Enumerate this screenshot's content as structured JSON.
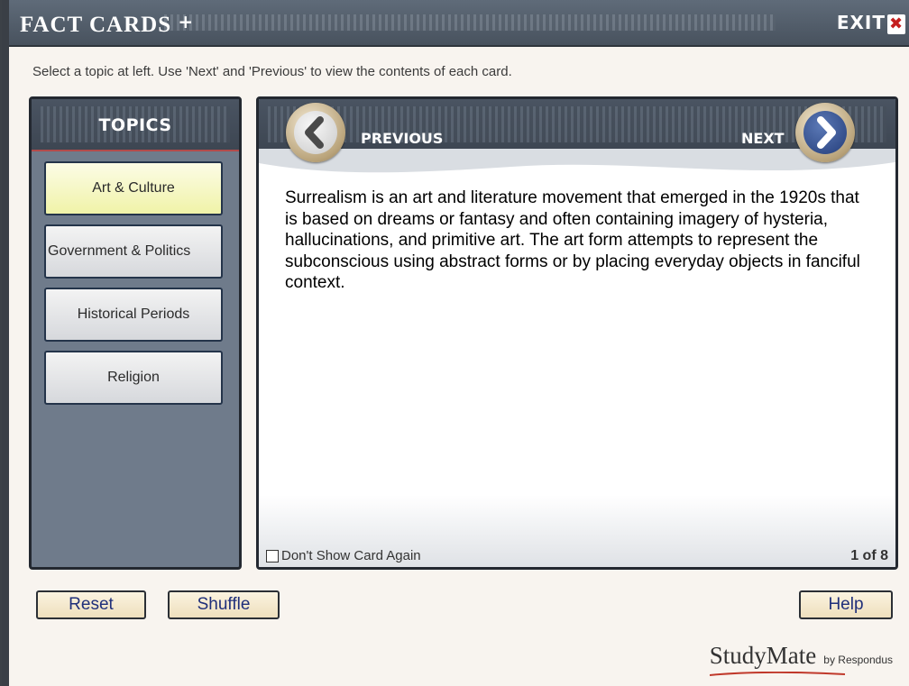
{
  "app": {
    "logo_text": "FACT CARDS",
    "logo_plus": "+",
    "exit_label": "EXIT",
    "exit_icon": "✖"
  },
  "instruction": "Select a topic at left. Use 'Next' and 'Previous' to view the contents of each card.",
  "topics": {
    "header": "TOPICS",
    "items": [
      {
        "label": "Art & Culture",
        "selected": true
      },
      {
        "label": "Government & Politics",
        "selected": false
      },
      {
        "label": "Historical Periods",
        "selected": false
      },
      {
        "label": "Religion",
        "selected": false
      }
    ]
  },
  "card": {
    "previous_label": "PREVIOUS",
    "next_label": "NEXT",
    "text": "Surrealism is an art and literature movement that emerged in the 1920s that is based on dreams or fantasy and often containing imagery of hysteria, hallucinations, and primitive art. The art form attempts to represent the subconscious using abstract forms or by placing everyday objects in fanciful context.",
    "dont_show_label": "Don't Show Card Again",
    "dont_show_checked": false,
    "counter": "1 of 8"
  },
  "buttons": {
    "reset": "Reset",
    "shuffle": "Shuffle",
    "help": "Help"
  },
  "brand": {
    "name": "StudyMate",
    "byline": "by Respondus"
  },
  "colors": {
    "panel_dark": "#3d4652",
    "panel_body": "#6f7b8b",
    "accent_red": "#b34b4b",
    "selected_topic": "#f0f3a8",
    "button_text": "#1f2f7a"
  }
}
